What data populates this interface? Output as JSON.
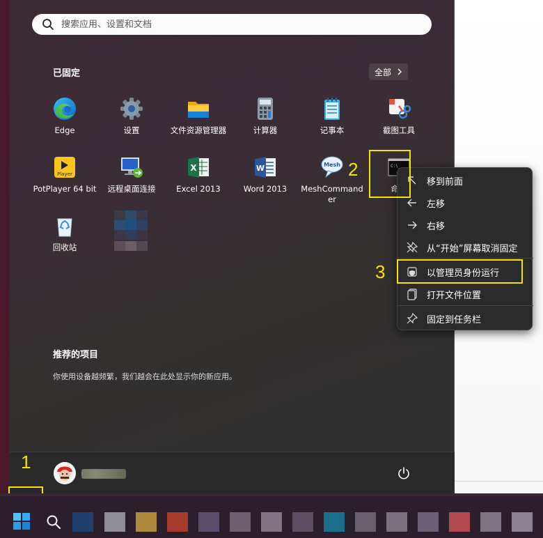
{
  "search": {
    "placeholder": "搜索应用、设置和文档"
  },
  "pinned": {
    "title": "已固定",
    "all_label": "全部",
    "apps": [
      {
        "label": "Edge",
        "icon": "edge-icon"
      },
      {
        "label": "设置",
        "icon": "settings-gear-icon"
      },
      {
        "label": "文件资源管理器",
        "icon": "folder-icon"
      },
      {
        "label": "计算器",
        "icon": "calculator-icon"
      },
      {
        "label": "记事本",
        "icon": "notepad-icon"
      },
      {
        "label": "截图工具",
        "icon": "snipping-tool-icon"
      },
      {
        "label": "PotPlayer 64 bit",
        "icon": "potplayer-icon",
        "icon_text": "Player"
      },
      {
        "label": "远程桌面连接",
        "icon": "remote-desktop-icon"
      },
      {
        "label": "Excel 2013",
        "icon": "excel-icon"
      },
      {
        "label": "Word 2013",
        "icon": "word-icon"
      },
      {
        "label": "MeshCommander",
        "icon": "mesh-icon",
        "icon_text": "Mesh"
      },
      {
        "label": "命令",
        "icon": "cmd-icon",
        "icon_text": "C:\\_"
      },
      {
        "label": "回收站",
        "icon": "recycle-bin-icon"
      }
    ]
  },
  "recommended": {
    "title": "推荐的项目",
    "description": "你使用设备越频繁，我们越会在此处显示你的新应用。"
  },
  "context_menu": {
    "items": [
      {
        "label": "移到前面",
        "icon": "arrow-up-left-icon"
      },
      {
        "label": "左移",
        "icon": "arrow-left-icon"
      },
      {
        "label": "右移",
        "icon": "arrow-right-icon"
      },
      {
        "label": "从“开始”屏幕取消固定",
        "icon": "unpin-icon"
      },
      {
        "label": "以管理员身份运行",
        "icon": "shield-admin-icon"
      },
      {
        "label": "打开文件位置",
        "icon": "open-folder-icon"
      },
      {
        "label": "固定到任务栏",
        "icon": "pin-icon"
      }
    ]
  },
  "annotations": {
    "step1": "1",
    "step2": "2",
    "step3": "3"
  },
  "colors": {
    "highlight": "#f5e300",
    "menu_bg": "#2b2b2b",
    "accent": "#0078d4"
  }
}
